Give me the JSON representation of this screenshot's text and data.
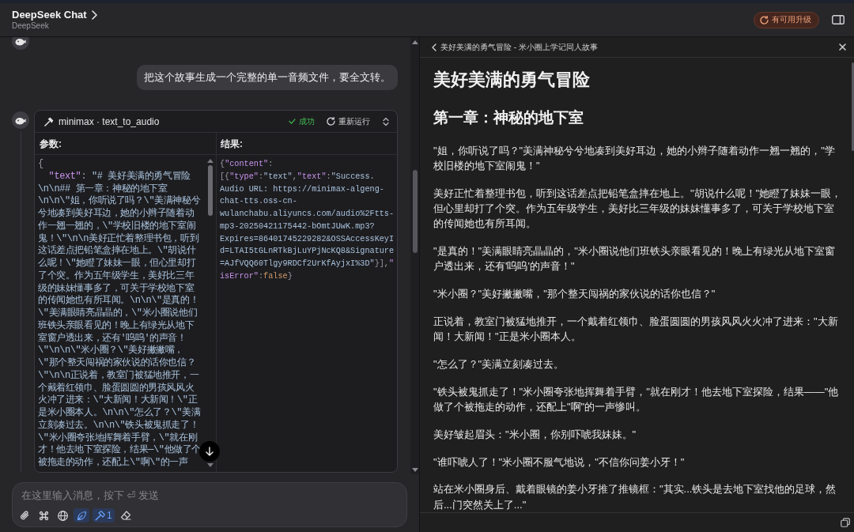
{
  "window": {
    "title": "DeepSeek Chat",
    "subtitle": "DeepSeek"
  },
  "header": {
    "upgrade": "有可用升级"
  },
  "chat": {
    "messages": [
      {
        "kind": "assistant"
      },
      {
        "kind": "user",
        "text": "把这个故事生成一个完整的单一音频文件，要全文转。"
      },
      {
        "kind": "tool_call",
        "tool": "minimax · text_to_audio",
        "success": true,
        "status": "成功",
        "rerun": "重新运行",
        "params_label": "参数:",
        "result_label": "结果:",
        "params_code": [
          {
            "kind": "punct",
            "text": "{\n  "
          },
          {
            "kind": "key",
            "text": "\"text\""
          },
          {
            "kind": "punct",
            "text": ": "
          },
          {
            "kind": "string",
            "text": "\"# 美好美满的勇气冒险\\n\\n## 第一章：神秘的地下室\\n\\n\\\"姐，你听说了吗？\\\"美满神秘兮兮地凑到美好耳边，她的小辫子随着动作一翘一翘的，\\\"学校旧楼的地下室闹鬼！\\\"\\n\\n美好正忙着整理书包，听到这话差点把铅笔盒摔在地上。\\\"胡说什么呢！\\\"她瞪了妹妹一眼，但心里却打了个突。作为五年级学生，美好比三年级的妹妹懂事多了，可关于学校地下室的传闻她也有所耳闻。\\n\\n\\\"是真的！\\\"美满眼睛亮晶晶的，\\\"米小圈说他们班铁头亲眼看见的！晚上有绿光从地下室窗户透出来，还有'呜呜'的声音！\\\"\\n\\n\\\"米小圈？\\\"美好撇撇嘴，\\\"那个整天闯祸的家伙说的话你也信？\\\"\\n\\n正说着，教室门被猛地推开，一个戴着红领巾、脸蛋圆圆的男孩风风火火冲了进来：\\\"大新闻！大新闻！\\\"正是米小圈本人。\\n\\n\\\"怎么了？\\\"美满立刻凑过去。\\n\\n\\\"铁头被鬼抓走了！\\\"米小圈夸张地挥舞着手臂，\\\"就在刚才！他去地下室探险，结果—\\\"他做了个被拖走的动作，还配上\\\"啊\\\"的一声"
          }
        ],
        "result_code": [
          {
            "kind": "punct",
            "text": "{"
          },
          {
            "kind": "key",
            "text": "\"content\""
          },
          {
            "kind": "punct",
            "text": ":"
          },
          {
            "kind": "punct",
            "text": "[{"
          },
          {
            "kind": "key",
            "text": "\"type\""
          },
          {
            "kind": "punct",
            "text": ":"
          },
          {
            "kind": "string",
            "text": "\"text\""
          },
          {
            "kind": "punct",
            "text": ","
          },
          {
            "kind": "key",
            "text": "\"text\""
          },
          {
            "kind": "punct",
            "text": ":"
          },
          {
            "kind": "string",
            "text": "\"Success. Audio URL: https://minimax-algeng-chat-tts.oss-cn-wulanchabu.aliyuncs.com/audio%2Ftts-mp3-20250421175442-bOmtJUwK.mp3?Expires=86401745229282&OSSAccessKeyId=LTAI5tGLnRTkBjLuYPjNcKQ8&Signature=AJfVQQ60Tlgy9RDCf2UrKfAyjxI%3D\""
          },
          {
            "kind": "punct",
            "text": "}],"
          },
          {
            "kind": "key",
            "text": "\"isError\""
          },
          {
            "kind": "punct",
            "text": ":"
          },
          {
            "kind": "bool",
            "text": "false"
          },
          {
            "kind": "punct",
            "text": "}"
          }
        ]
      }
    ]
  },
  "composer": {
    "placeholder": "在这里输入消息，按下 ⏎ 发送",
    "tools": [
      {
        "kind": "attach",
        "selected": false
      },
      {
        "kind": "commands",
        "selected": false
      },
      {
        "kind": "web",
        "selected": false
      },
      {
        "kind": "reasoning",
        "selected": true
      },
      {
        "kind": "tools",
        "selected": true,
        "count": "1"
      },
      {
        "kind": "clear",
        "selected": false
      }
    ]
  },
  "side_panel": {
    "breadcrumb": "美好美满的勇气冒险 - 米小圈上学记同人故事",
    "title": "美好美满的勇气冒险",
    "heading": "第一章：神秘的地下室",
    "paragraphs": [
      "\"姐，你听说了吗？\"美满神秘兮兮地凑到美好耳边，她的小辫子随着动作一翘一翘的，\"学校旧楼的地下室闹鬼！\"",
      "美好正忙着整理书包，听到这话差点把铅笔盒摔在地上。\"胡说什么呢！\"她瞪了妹妹一眼，但心里却打了个突。作为五年级学生，美好比三年级的妹妹懂事多了，可关于学校地下室的传闻她也有所耳闻。",
      "\"是真的！\"美满眼睛亮晶晶的，\"米小圈说他们班铁头亲眼看见的！晚上有绿光从地下室窗户透出来，还有'呜呜'的声音！\"",
      "\"米小圈？\"美好撇撇嘴，\"那个整天闯祸的家伙说的话你也信？\"",
      "正说着，教室门被猛地推开，一个戴着红领巾、脸蛋圆圆的男孩风风火火冲了进来：\"大新闻！大新闻！\"正是米小圈本人。",
      "\"怎么了？\"美满立刻凑过去。",
      "\"铁头被鬼抓走了！\"米小圈夸张地挥舞着手臂，\"就在刚才！他去地下室探险，结果——\"他做了个被拖走的动作，还配上\"啊\"的一声惨叫。",
      "美好皱起眉头：\"米小圈，你别吓唬我妹妹。\"",
      "\"谁吓唬人了！\"米小圈不服气地说，\"不信你问姜小牙！\"",
      "站在米小圈身后、戴着眼镜的姜小牙推了推镜框：\"其实...铁头是去地下室找他的足球，然后...门突然关上了...\""
    ]
  }
}
